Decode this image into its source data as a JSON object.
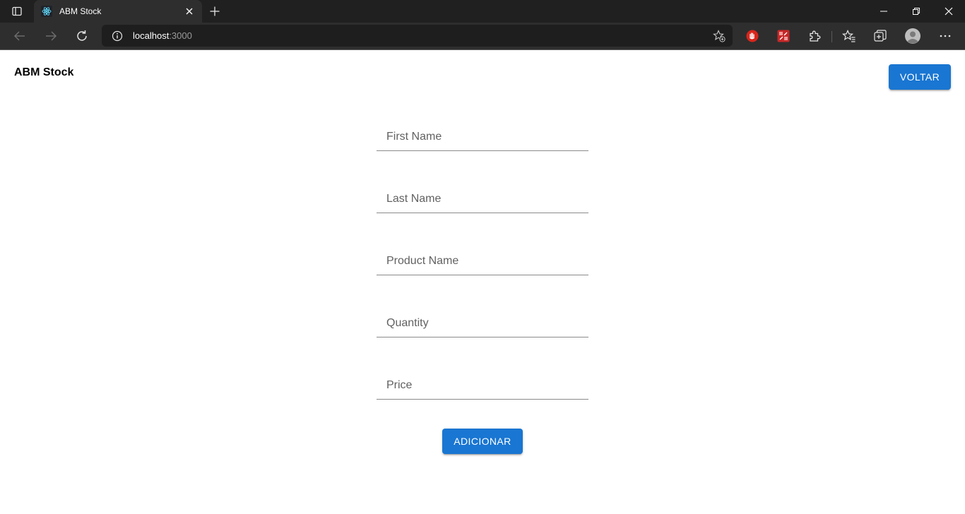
{
  "browser": {
    "tab": {
      "title": "ABM Stock"
    },
    "address": {
      "host": "localhost",
      "port": ":3000"
    }
  },
  "header": {
    "title": "ABM Stock",
    "back_label": "VOLTAR"
  },
  "form": {
    "fields": [
      {
        "placeholder": "First Name",
        "value": ""
      },
      {
        "placeholder": "Last Name",
        "value": ""
      },
      {
        "placeholder": "Product Name",
        "value": ""
      },
      {
        "placeholder": "Quantity",
        "value": ""
      },
      {
        "placeholder": "Price",
        "value": ""
      }
    ],
    "submit_label": "ADICIONAR"
  },
  "colors": {
    "primary": "#1976d2",
    "chrome_dark": "#202020",
    "chrome_tab": "#2e2e2e"
  }
}
